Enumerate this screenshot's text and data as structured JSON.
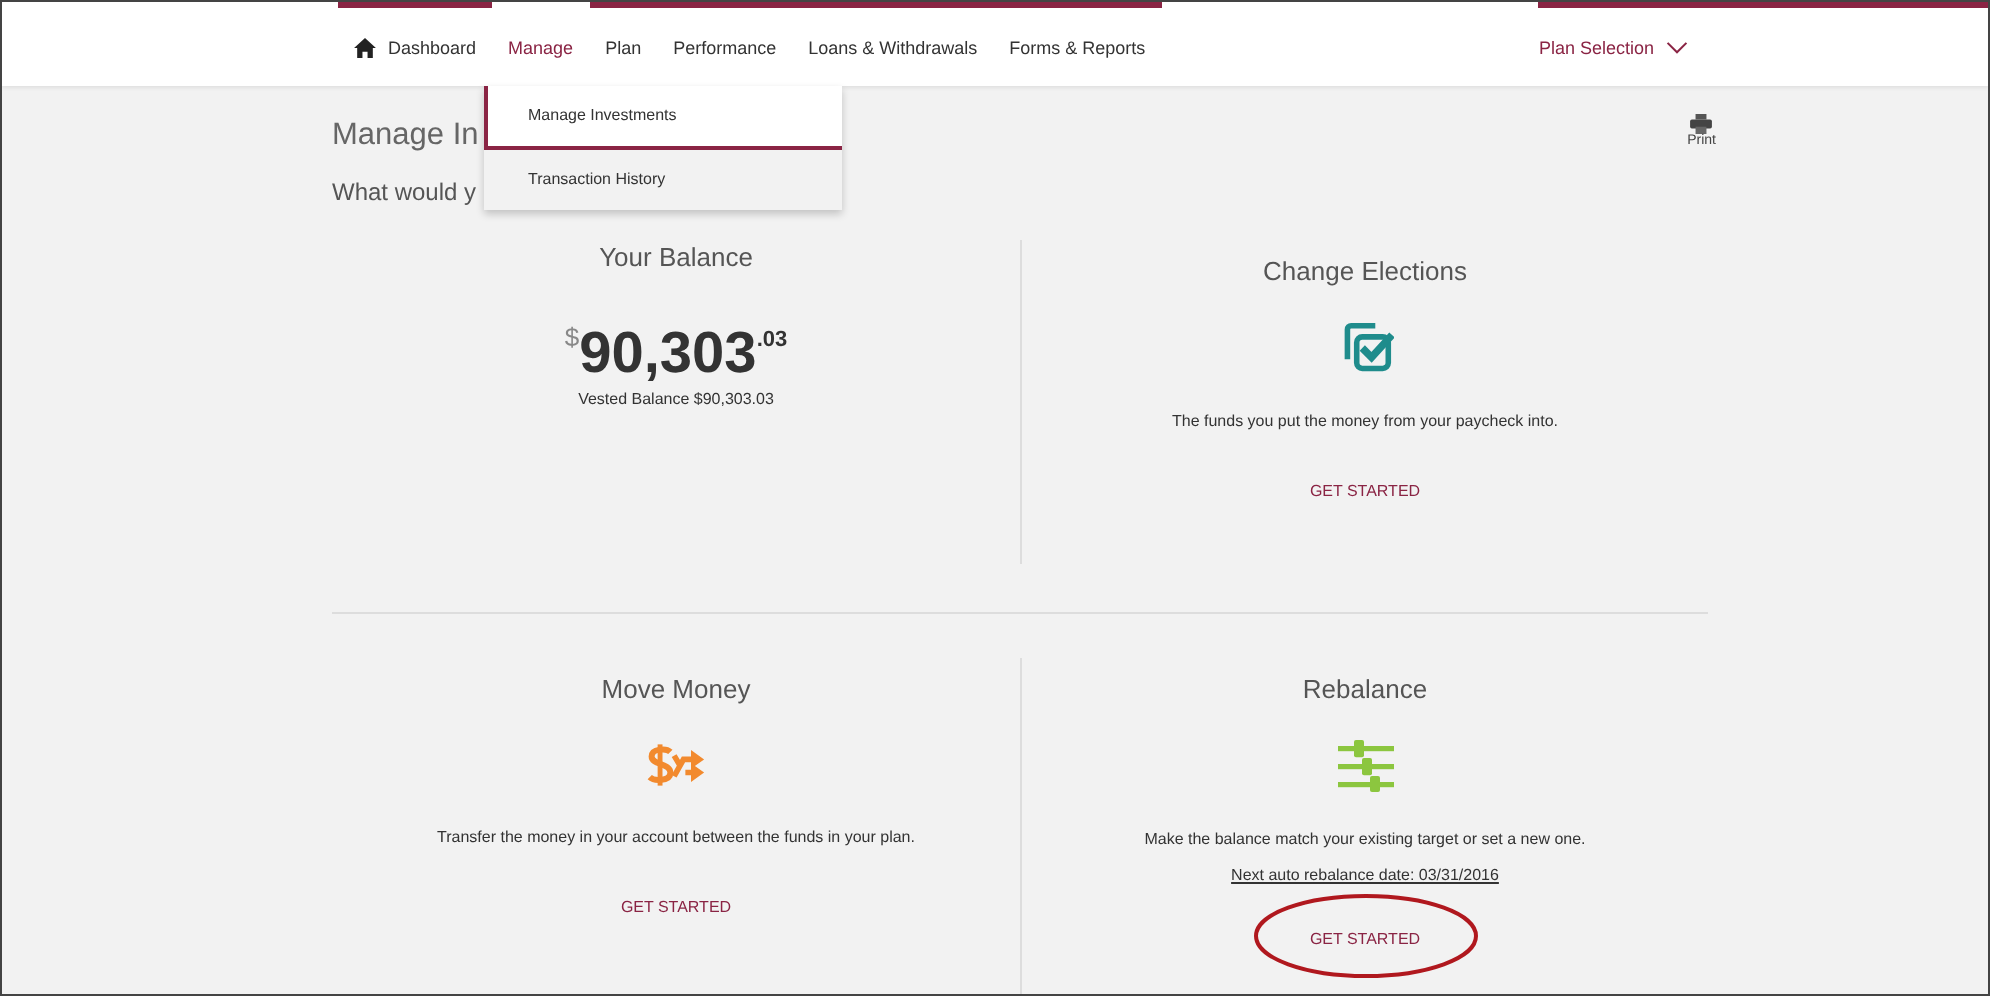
{
  "nav": {
    "items": [
      {
        "label": "Dashboard",
        "selected": false,
        "kind": "home"
      },
      {
        "label": "Manage",
        "selected": true
      },
      {
        "label": "Plan",
        "selected": false
      },
      {
        "label": "Performance",
        "selected": false
      },
      {
        "label": "Loans & Withdrawals",
        "selected": false
      },
      {
        "label": "Forms & Reports",
        "selected": false
      }
    ],
    "plan_selection": "Plan Selection"
  },
  "dropdown": [
    {
      "label": "Manage Investments",
      "selected": true
    },
    {
      "label": "Transaction History",
      "selected": false
    }
  ],
  "heading": "Manage In",
  "subheading": "What would y",
  "print": "Print",
  "cards": [
    {
      "kind": "balance",
      "title": "Your Balance",
      "currency": "$",
      "whole": "90,303",
      "cents": ".03",
      "vested": "Vested Balance $90,303.03"
    },
    {
      "kind": "elections",
      "title": "Change Elections",
      "description": "The funds you put the money from your paycheck into.",
      "action": "GET STARTED",
      "circled": false
    },
    {
      "kind": "move",
      "title": "Move Money",
      "description": "Transfer the money in your account between the funds in your plan.",
      "action": "GET STARTED",
      "circled": false
    },
    {
      "kind": "rebalance",
      "title": "Rebalance",
      "description": "Make the balance match your existing target or set a new one.",
      "note": "Next auto rebalance date: 03/31/2016",
      "action": "GET STARTED",
      "circled": true
    }
  ]
}
